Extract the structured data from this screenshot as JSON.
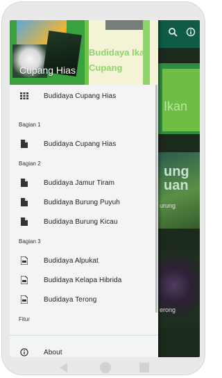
{
  "background_app": {
    "card1_text": "Ikan",
    "card2_title": "ung uan",
    "card2_subtitle": "urung",
    "card3_subtitle": "erong",
    "toolbar_icons": [
      "search-icon",
      "info-icon"
    ]
  },
  "drawer_header": {
    "title_left": "Cupang Hias",
    "title_right_line1": "Budidaya Ikan",
    "title_right_line2": "Cupang"
  },
  "menu": {
    "top_item": {
      "label": "Budidaya Cupang Hias",
      "icon": "grid-icon"
    },
    "sections": [
      {
        "title": "Bagian 1",
        "items": [
          {
            "label": "Budidaya Cupang Hias",
            "icon": "document-icon"
          }
        ]
      },
      {
        "title": "Bagian 2",
        "items": [
          {
            "label": "Budidaya Jamur Tiram",
            "icon": "document-icon"
          },
          {
            "label": "Budidaya Burung Puyuh",
            "icon": "document-icon"
          },
          {
            "label": "Budidaya Burung Kicau",
            "icon": "document-icon"
          }
        ]
      },
      {
        "title": "Bagian 3",
        "items": [
          {
            "label": "Budidaya Alpukat",
            "icon": "pdf-icon"
          },
          {
            "label": "Budidaya Kelapa Hibrida",
            "icon": "pdf-icon"
          },
          {
            "label": "Budidaya Terong",
            "icon": "pdf-icon"
          }
        ]
      },
      {
        "title": "Fitur",
        "items": []
      }
    ],
    "about": {
      "label": "About",
      "icon": "info-icon"
    }
  },
  "colors": {
    "toolbar": "#0f5b48",
    "drawer_bg": "#f3f5f5",
    "header_green": "#3aa13f",
    "header_light_green": "#8fd46b"
  }
}
